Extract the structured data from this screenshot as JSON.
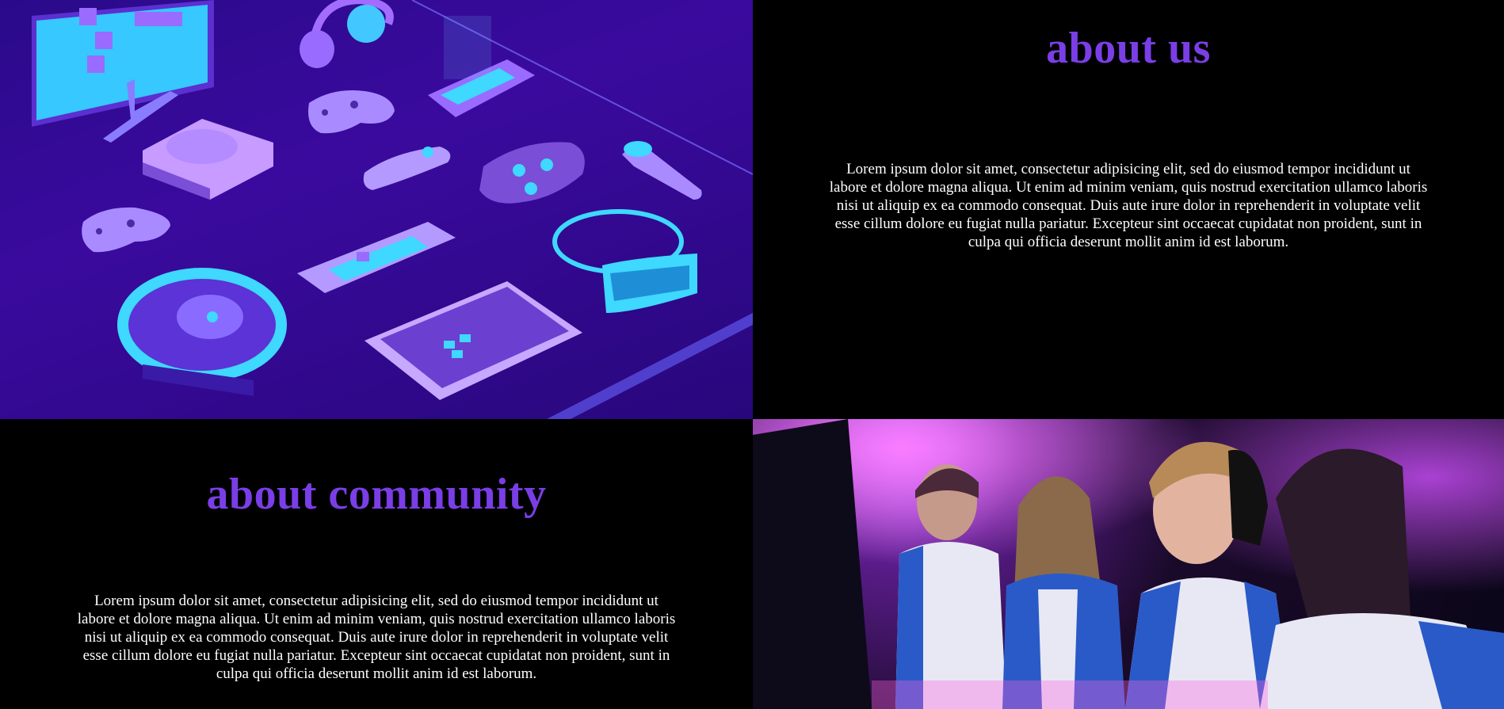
{
  "about_us": {
    "heading": "about us",
    "paragraph": "Lorem ipsum dolor sit amet, consectetur adipisicing elit, sed do eiusmod tempor incididunt ut labore et dolore magna aliqua. Ut enim ad minim veniam, quis nostrud exercitation ullamco laboris nisi ut aliquip ex ea commodo consequat. Duis aute irure dolor in reprehenderit in voluptate velit esse cillum dolore eu fugiat nulla pariatur. Excepteur sint occaecat cupidatat non proident, sunt in culpa qui officia deserunt mollit anim id est laborum."
  },
  "about_community": {
    "heading": "about community",
    "paragraph": "Lorem ipsum dolor sit amet, consectetur adipisicing elit, sed do eiusmod tempor incididunt ut labore et dolore magna aliqua. Ut enim ad minim veniam, quis nostrud exercitation ullamco laboris nisi ut aliquip ex ea commodo consequat. Duis aute irure dolor in reprehenderit in voluptate velit esse cillum dolore eu fugiat nulla pariatur. Excepteur sint occaecat cupidatat non proident, sunt in culpa qui officia deserunt mollit anim id est laborum."
  },
  "colors": {
    "heading": "#7a3ee6",
    "background": "#000000",
    "text": "#ffffff",
    "illustration_bg": "#3a0a9e",
    "accent_cyan": "#3fd8ff"
  }
}
